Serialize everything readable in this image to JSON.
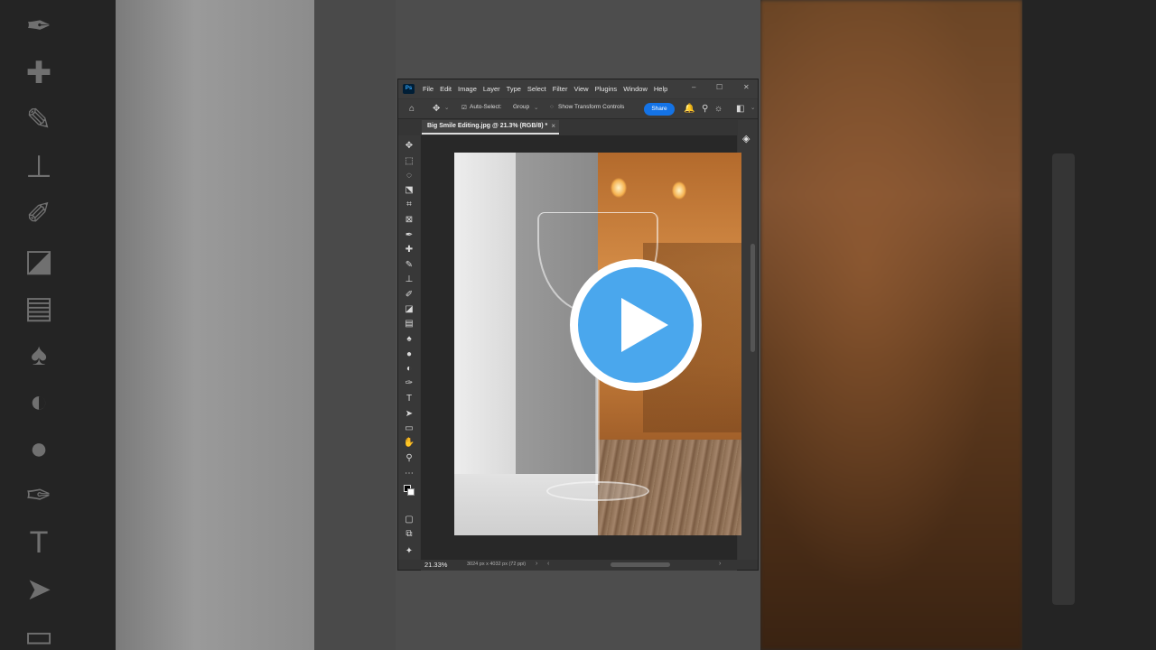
{
  "app": {
    "logo": "Ps",
    "menu": [
      "File",
      "Edit",
      "Image",
      "Layer",
      "Type",
      "Select",
      "Filter",
      "View",
      "Plugins",
      "Window",
      "Help"
    ],
    "window_controls": {
      "minimize": "–",
      "maximize": "☐",
      "close": "✕"
    }
  },
  "options_bar": {
    "home_icon": "home-icon",
    "move_icon": "move-icon",
    "auto_select_label": "Auto-Select:",
    "auto_select_value": "Group",
    "show_transform_label": "Show Transform Controls",
    "share_label": "Share"
  },
  "document": {
    "tab_title": "Big Smile Editing.jpg @ 21.3% (RGB/8) *",
    "close": "×"
  },
  "status": {
    "zoom": "21.33%",
    "doc_info": "3024 px x 4032 px (72 ppi)"
  },
  "colors": {
    "accent": "#1473e6",
    "play_button": "#4aa7ed",
    "ui_dark": "#353535"
  },
  "tools": [
    "move-icon",
    "marquee-icon",
    "lasso-icon",
    "object-select-icon",
    "crop-icon",
    "frame-icon",
    "eyedropper-icon",
    "healing-brush-icon",
    "brush-icon",
    "clone-stamp-icon",
    "history-brush-icon",
    "eraser-icon",
    "gradient-icon",
    "blur-icon",
    "dodge-icon",
    "burn-icon",
    "pen-icon",
    "type-icon",
    "path-select-icon",
    "rectangle-icon",
    "hand-icon",
    "zoom-icon",
    "more-tools-icon",
    "color-swatches-icon",
    "quick-mask-icon",
    "screen-mode-icon",
    "generative-icon"
  ],
  "tool_glyphs": [
    "✥",
    "⬚",
    "◌",
    "⬔",
    "⌗",
    "⊠",
    "✒",
    "✚",
    "✎",
    "⊥",
    "✐",
    "◪",
    "▤",
    "♠",
    "●",
    "◐",
    "✑",
    "T",
    "➤",
    "▭",
    "✋",
    "⚲",
    "⋯",
    "◧",
    "▢",
    "⧉",
    "✦"
  ]
}
